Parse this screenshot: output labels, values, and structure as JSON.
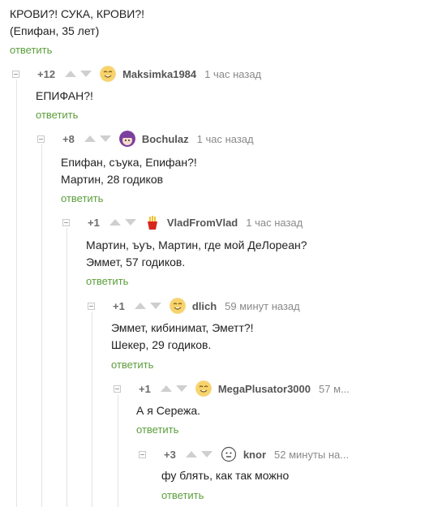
{
  "top_comment": {
    "line1": "КРОВИ?! СУКА, КРОВИ?!",
    "line2": "(Епифан, 35 лет)",
    "reply": "ответить"
  },
  "comments": [
    {
      "rating": "+12",
      "user": "Maksimka1984",
      "time": "1 час назад",
      "lines": [
        "ЕПИФАН?!"
      ],
      "reply": "ответить",
      "avatar_icon": "smiley-avatar-icon"
    },
    {
      "rating": "+8",
      "user": "Bochulaz",
      "time": "1 час назад",
      "lines": [
        "Епифан, съука, Епифан?!",
        "Мартин, 28 годиков"
      ],
      "reply": "ответить",
      "avatar_icon": "anime-girl-avatar-icon"
    },
    {
      "rating": "+1",
      "user": "VladFromVlad",
      "time": "1 час назад",
      "lines": [
        "Мартин, ъуъ, Мартин, где мой ДеЛореан?",
        "Эммет, 57 годиков."
      ],
      "reply": "ответить",
      "avatar_icon": "fries-avatar-icon"
    },
    {
      "rating": "+1",
      "user": "dlich",
      "time": "59 минут назад",
      "lines": [
        "Эммет, кибинимат, Эметт?!",
        "Шекер, 29 годиков."
      ],
      "reply": "ответить",
      "avatar_icon": "smiley-avatar-icon"
    },
    {
      "rating": "+1",
      "user": "MegaPlusator3000",
      "time": "57 м...",
      "lines": [
        "А я Сережа."
      ],
      "reply": "ответить",
      "avatar_icon": "smiley-avatar-icon"
    },
    {
      "rating": "+3",
      "user": "knor",
      "time": "52 минуты на...",
      "lines": [
        "фу блять, как так можно"
      ],
      "reply": "ответить",
      "avatar_icon": "neutral-face-avatar-icon"
    }
  ],
  "colors": {
    "reply": "#5b9e3b",
    "text": "#222222",
    "meta": "#8a8a8a",
    "tree_line": "#e4e4e4"
  }
}
